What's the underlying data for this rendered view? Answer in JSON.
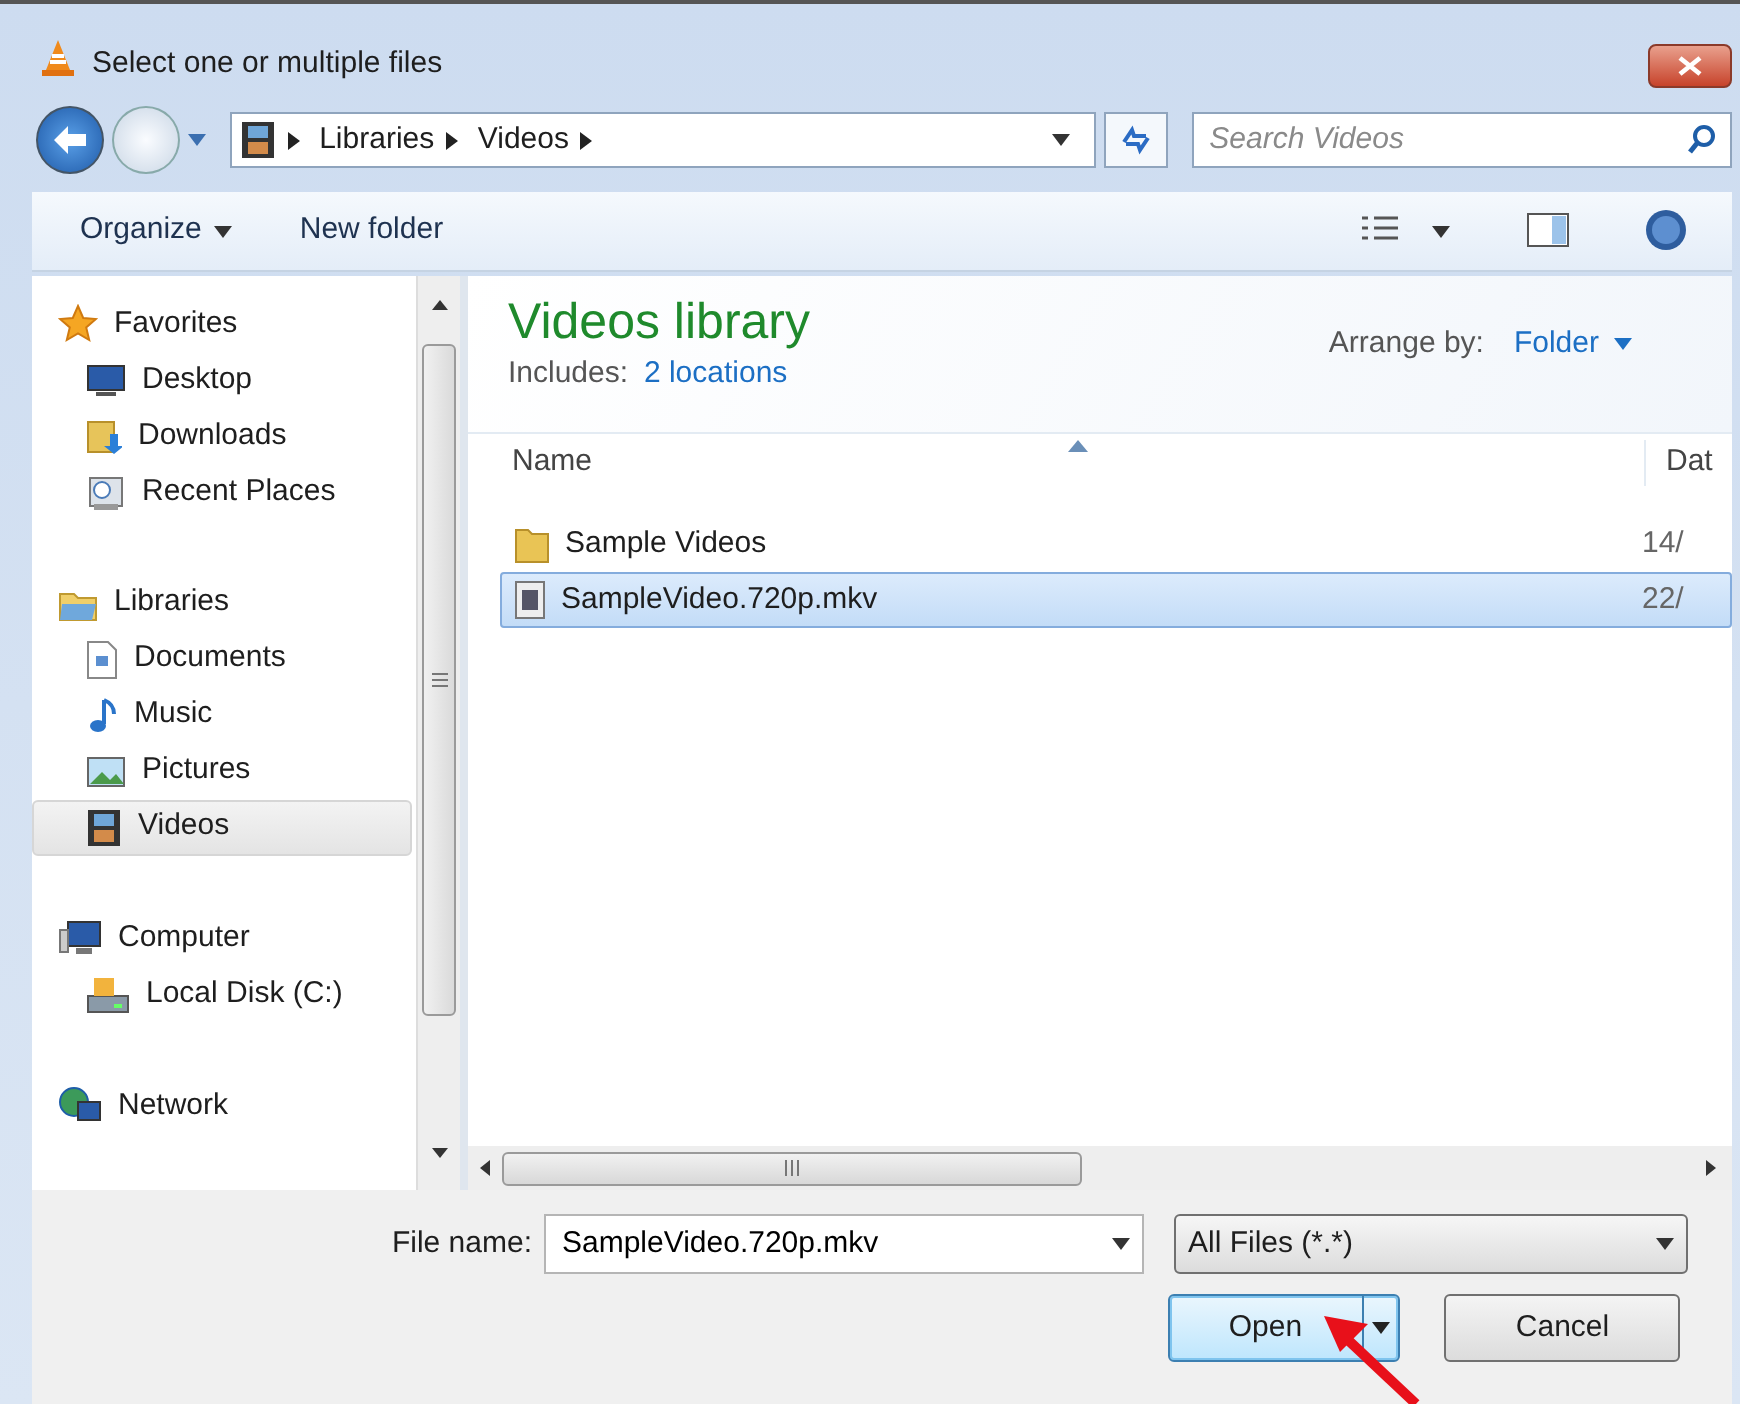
{
  "window": {
    "title": "Select one or multiple files"
  },
  "address_bar": {
    "path": [
      "Libraries",
      "Videos"
    ]
  },
  "search": {
    "placeholder": "Search Videos"
  },
  "toolbar": {
    "organize": "Organize",
    "new_folder": "New folder"
  },
  "navigation": [
    {
      "label": "Favorites",
      "selected": false,
      "children": [
        {
          "label": "Desktop",
          "selected": false
        },
        {
          "label": "Downloads",
          "selected": false
        },
        {
          "label": "Recent Places",
          "selected": false
        }
      ]
    },
    {
      "label": "Libraries",
      "selected": false,
      "children": [
        {
          "label": "Documents",
          "selected": false
        },
        {
          "label": "Music",
          "selected": false
        },
        {
          "label": "Pictures",
          "selected": false
        },
        {
          "label": "Videos",
          "selected": true
        }
      ]
    },
    {
      "label": "Computer",
      "selected": false,
      "children": [
        {
          "label": "Local Disk (C:)",
          "selected": false
        }
      ]
    },
    {
      "label": "Network",
      "selected": false
    }
  ],
  "library": {
    "title": "Videos library",
    "includes_label": "Includes:",
    "locations_link": "2 locations",
    "arrange_label": "Arrange by:",
    "arrange_value": "Folder"
  },
  "file_list": {
    "columns": [
      {
        "label": "Name",
        "sorted": true
      },
      {
        "label": "Dat",
        "sorted": false
      }
    ],
    "rows": [
      {
        "kind": "folder",
        "name": "Sample Videos",
        "date": "14/",
        "selected": false
      },
      {
        "kind": "video",
        "name": "SampleVideo.720p.mkv",
        "date": "22/",
        "selected": true
      }
    ]
  },
  "file_name": {
    "label": "File name:",
    "value": "SampleVideo.720p.mkv"
  },
  "file_type": {
    "value": "All Files (*.*)"
  },
  "buttons": [
    {
      "label": "Open",
      "kind": "split",
      "default": true
    },
    {
      "label": "Cancel",
      "kind": "plain",
      "default": false
    }
  ]
}
